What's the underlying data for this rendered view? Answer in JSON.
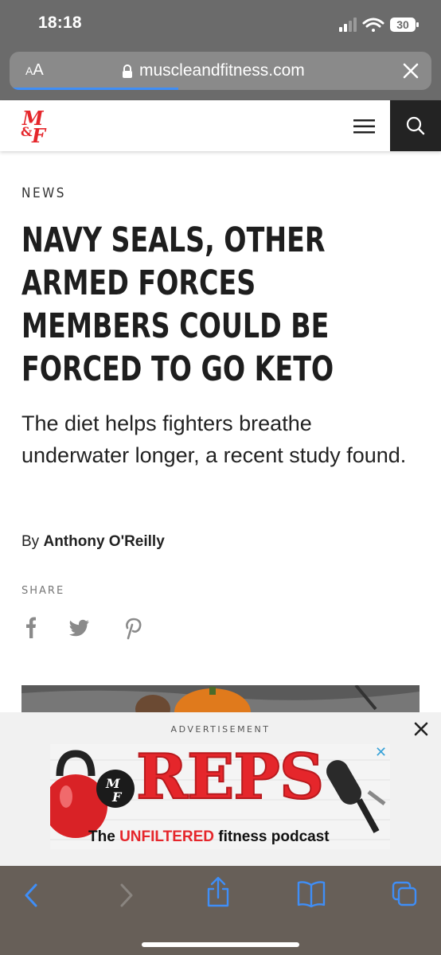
{
  "status_bar": {
    "time": "18:18",
    "battery": "30"
  },
  "browser": {
    "aa_label_small": "A",
    "aa_label_large": "A",
    "url": "muscleandfitness.com",
    "load_progress": 0.4
  },
  "site": {
    "logo_top": "M",
    "logo_bottom": "F",
    "logo_amp": "&"
  },
  "article": {
    "category": "NEWS",
    "headline_lines": [
      "NAVY SEALS, OTHER",
      "ARMED FORCES",
      "MEMBERS COULD BE",
      "FORCED TO GO KETO"
    ],
    "dek": "The diet helps fighters breathe underwater longer, a recent study found.",
    "byline_prefix": "By",
    "author": "Anthony O'Reilly",
    "share_label": "SHARE"
  },
  "ad": {
    "label": "ADVERTISEMENT",
    "title": "REPS",
    "sub_the": "The ",
    "sub_red": "UNFILTERED",
    "sub_rest": " fitness podcast"
  },
  "colors": {
    "accent_red": "#e5262b",
    "load_bar": "#3f8ef7",
    "toolbar_icon": "#3f8ef7"
  }
}
